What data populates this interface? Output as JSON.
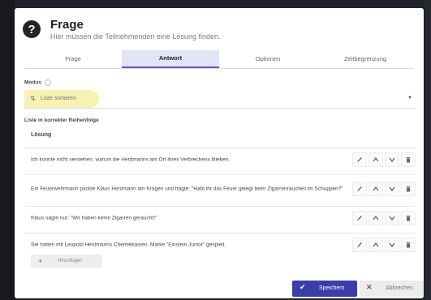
{
  "dialog": {
    "title": "Frage",
    "subtitle": "Hier müssen die Teilnehmenden eine Lösung finden."
  },
  "tabs": [
    {
      "label": "Frage",
      "active": false
    },
    {
      "label": "Antwort",
      "active": true
    },
    {
      "label": "Optionen",
      "active": false
    },
    {
      "label": "Zeitbegrenzung",
      "active": false
    }
  ],
  "modus": {
    "label": "Modus",
    "value": "Liste sortieren"
  },
  "list": {
    "label": "Liste in korrekter Reihenfolge",
    "header": "Lösung",
    "items": [
      "Ich konnte nicht verstehen, warum die Herdmanns am Ort ihres Verbrechens blieben.",
      "Ein Feuerwehrmann packte Klaus Herdmann am Kragen und fragte: \"Habt ihr das Feuer gelegt beim Zigarrenrauchen im Schuppen?\"",
      "Klaus sagte nur: \"Wir haben keine Zigarren geraucht!\"",
      "Sie hatten mit Leopold Herdmanns Chemiekasten, Marke \"Einstein Junior\" gespielt."
    ],
    "add_label": "Hinzufügen"
  },
  "footer": {
    "save_label": "Speichern",
    "cancel_label": "Abbrechen"
  },
  "colors": {
    "accent": "#3b3ea8",
    "tab_active_bg": "#e2e3f5",
    "highlight": "#f6f2b4"
  }
}
